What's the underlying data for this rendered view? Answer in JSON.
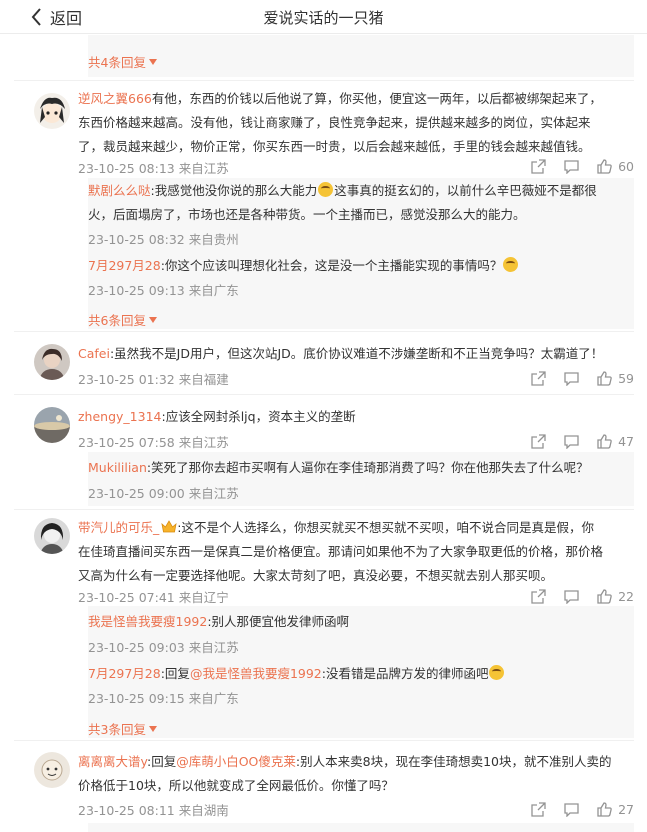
{
  "header": {
    "back_label": "返回",
    "title": "爱说实话的一只猪"
  },
  "top_more": "共4条回复",
  "comments": [
    {
      "user": "逆风之翼666",
      "lines": [
        "有他，东西的价钱以后他说了算，你买他，便宜这一两年，以后都被绑架起来了，",
        "东西价格越来越高。没有他，钱让商家赚了，良性竞争起来，提供越来越多的岗位，实体起来",
        "了，裁员越来越少，物价正常，你买东西一时贵，以后会越来越低，手里的钱会越来越值钱。"
      ],
      "meta": "23-10-25 08:13 来自江苏",
      "likes": "60",
      "replies": [
        {
          "user": "默剧么么哒",
          "line1_a": ":我感觉他没你说的那么大能力",
          "line1_b": "这事真的挺玄幻的，以前什么辛巴薇娅不是都很",
          "line2": "火，后面塌房了，市场也还是各种带货。一个主播而已，感觉没那么大的能力。",
          "meta": "23-10-25 08:32 来自贵州"
        },
        {
          "user": "7月297月28",
          "text": ":你这个应该叫理想化社会，这是没一个主播能实现的事情吗？",
          "meta": "23-10-25 09:13 来自广东"
        }
      ],
      "more": "共6条回复"
    },
    {
      "user": "Cafei",
      "text": ":虽然我不是JD用户，但这次站JD。底价协议难道不涉嫌垄断和不正当竞争吗？太霸道了！",
      "meta": "23-10-25 01:32 来自福建",
      "likes": "59"
    },
    {
      "user": "zhengy_1314",
      "text": ":应该全网封杀ljq，资本主义的垄断",
      "meta": "23-10-25 07:58 来自江苏",
      "likes": "47",
      "replies": [
        {
          "user": "Mukililian",
          "text": ":笑死了那你去超市买啊有人逼你在李佳琦那消费了吗？你在他那失去了什么呢？",
          "meta": "23-10-25 09:00 来自江苏"
        }
      ]
    },
    {
      "user": "带汽儿的可乐_",
      "lines": [
        ":这不是个人选择么，你想买就买不想买就不买呗，咱不说合同是真是假，你",
        "在佳琦直播间买东西一是保真二是价格便宜。那请问如果他不为了大家争取更低的价格，那价格",
        "又高为什么有一定要选择他呢。大家太苛刻了吧，真没必要，不想买就去别人那买呗。"
      ],
      "meta": "23-10-25 07:41 来自辽宁",
      "likes": "22",
      "replies": [
        {
          "user": "我是怪兽我要瘦1992",
          "text": ":别人那便宜他发律师函啊",
          "meta": "23-10-25 09:03 来自江苏"
        },
        {
          "user": "7月297月28",
          "mid": ":回复",
          "mention": "@我是怪兽我要瘦1992",
          "text": ":没看错是品牌方发的律师函吧",
          "meta": "23-10-25 09:15 来自广东"
        }
      ],
      "more": "共3条回复"
    },
    {
      "user": "离离离大谱y",
      "mid": ":回复",
      "mention": "@库萌小白OO傻克莱",
      "line1": ":别人本来卖8块，现在李佳琦想卖10块，就不准别人卖的",
      "line2": "价格低于10块，所以他就变成了全网最低价。你懂了吗？",
      "meta": "23-10-25 08:11 来自湖南",
      "likes": "27"
    }
  ],
  "colors": {
    "accent": "#eb7350",
    "meta": "#939393",
    "reply_bg": "#f7f7f7"
  }
}
